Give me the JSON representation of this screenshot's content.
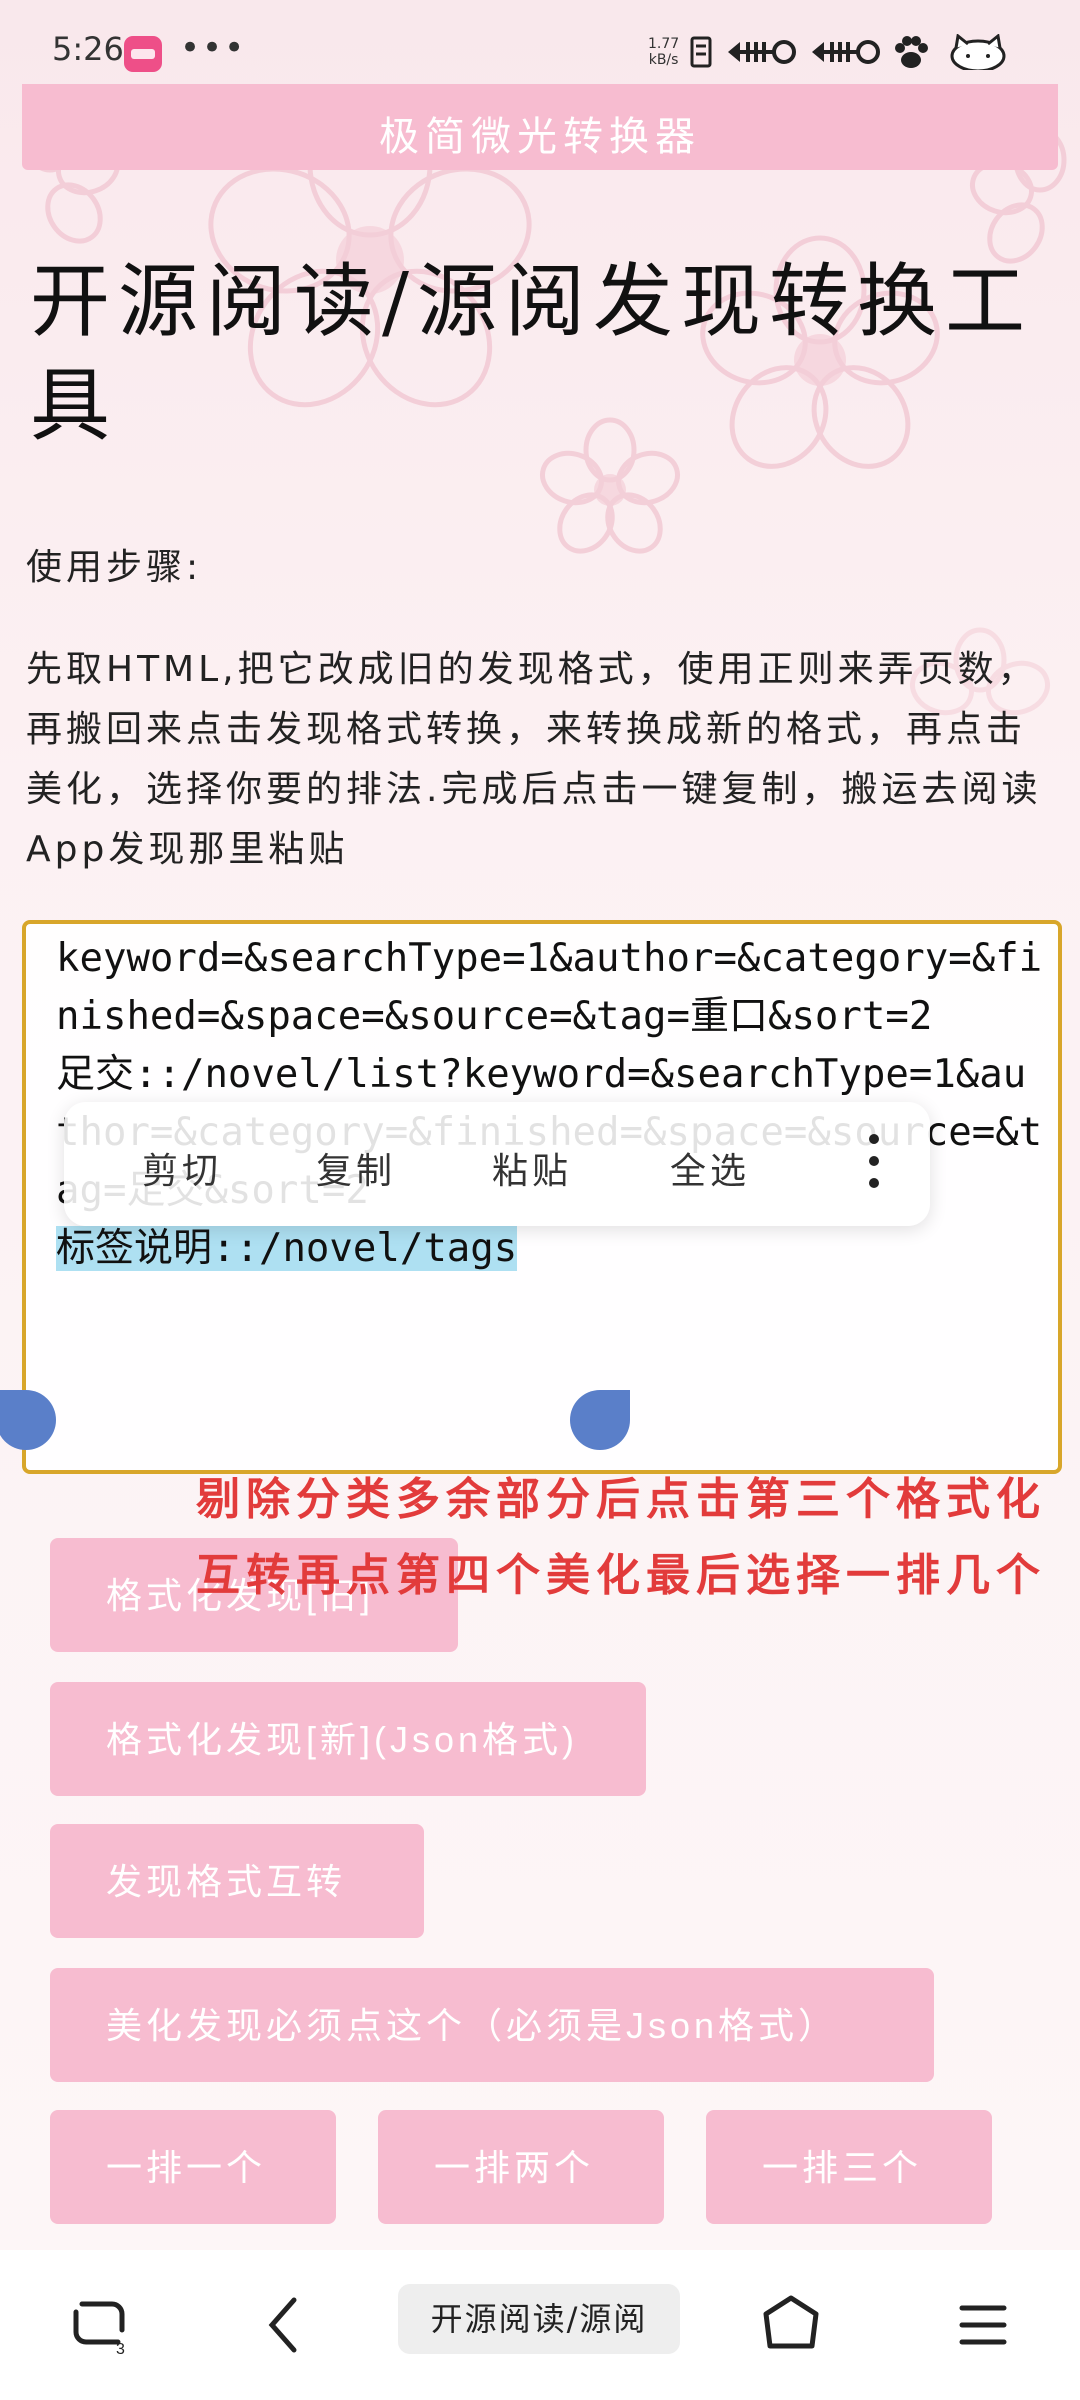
{
  "status_bar": {
    "time": "5:26",
    "more": "•••",
    "net_speed_value": "1.77",
    "net_speed_unit": "kB/s",
    "icons": [
      "bilibili-app-icon",
      "sim-icon",
      "signal-icon",
      "signal-icon",
      "paw-icon",
      "hello-kitty-battery-icon"
    ]
  },
  "app": {
    "title": "极简微光转换器"
  },
  "page": {
    "heading": "开源阅读/源阅发现转换工具",
    "steps_label": "使用步骤:",
    "description": "先取HTML,把它改成旧的发现格式，使用正则来弄页数，再搬回来点击发现格式转换，来转换成新的格式，再点击美化，选择你要的排法.完成后点击一键复制，搬运去阅读App发现那里粘贴"
  },
  "editor": {
    "line1": "keyword=&searchType=1&author=&category=&finished=&space=&source=&tag=重口&sort=2\n",
    "line2": "足交::/novel/list?keyword=&searchType=1&author=&category=&finished=&space=&source=&tag=足交&sort=2\n",
    "selected": "标签说明::/novel/tags"
  },
  "context_menu": {
    "items": [
      "剪切",
      "复制",
      "粘贴",
      "全选"
    ]
  },
  "annotation": "剔除分类多余部分后点击第三个格式化互转再点第四个美化最后选择一排几个",
  "buttons": {
    "format_old": "格式化发现[旧]",
    "format_new": "格式化发现[新](Json格式)",
    "convert": "发现格式互转",
    "beautify": "美化发现必须点这个（必须是Json格式）",
    "row_one": "一排一个",
    "row_two": "一排两个",
    "row_three": "一排三个"
  },
  "nav": {
    "current_page": "开源阅读/源阅",
    "tab_count": "3"
  },
  "colors": {
    "accent_pink": "#f7bcd0",
    "editor_border": "#d8a62a",
    "selection": "#aee0f2",
    "annotation_red": "#e23b3b"
  }
}
